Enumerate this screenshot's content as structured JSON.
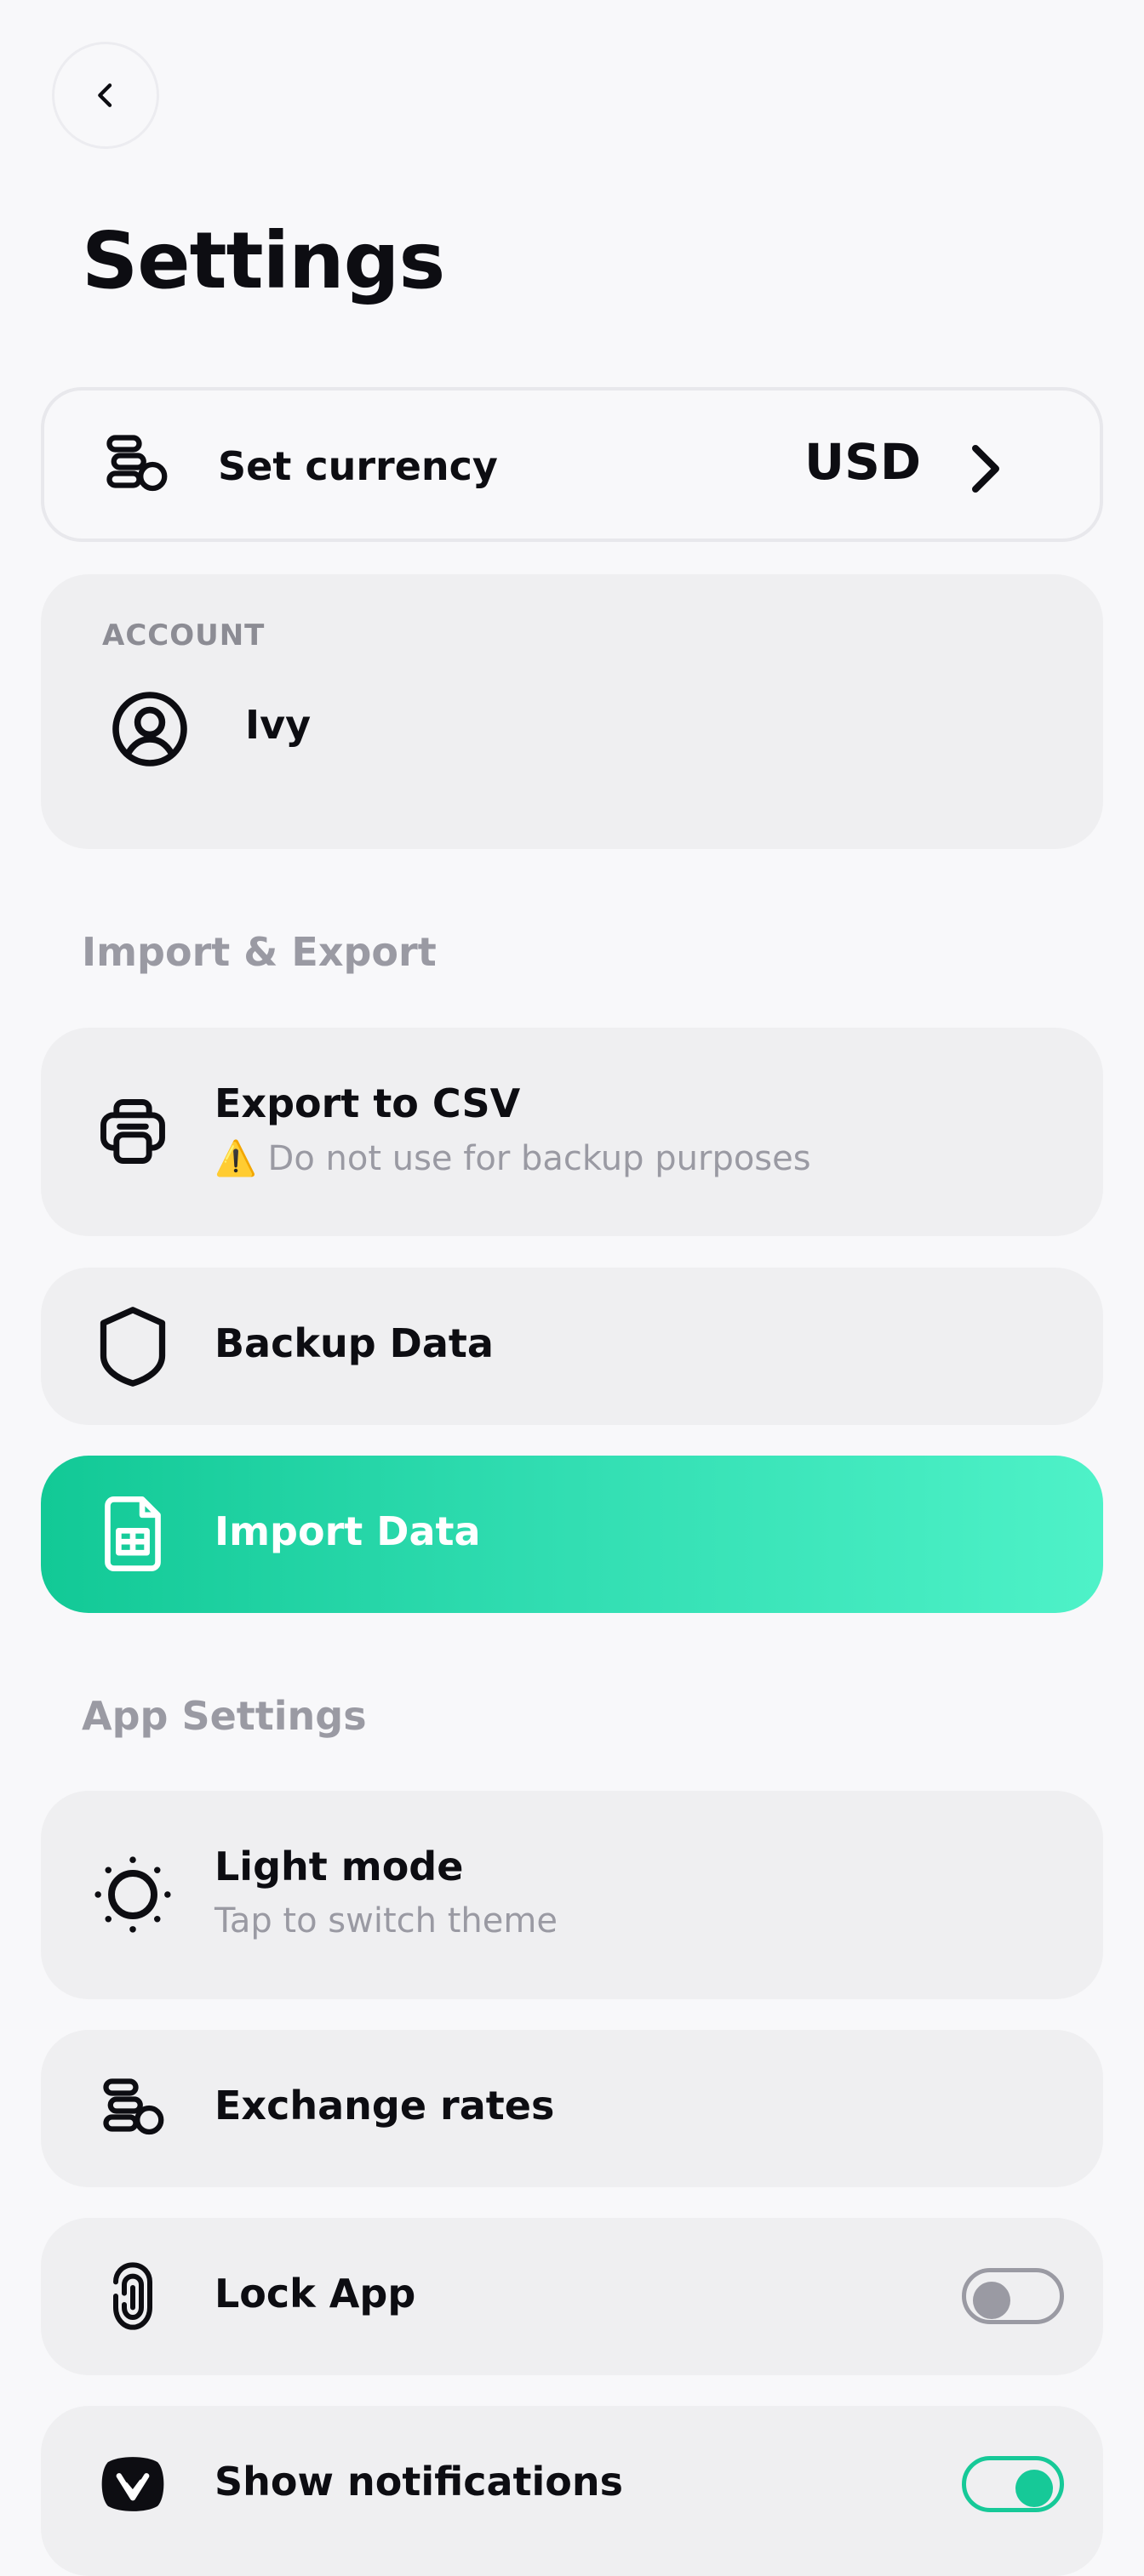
{
  "header": {
    "back_icon": "chevron-left-icon",
    "title": "Settings"
  },
  "currency": {
    "label": "Set currency",
    "value": "USD",
    "icon": "coins-icon"
  },
  "account": {
    "section_label": "ACCOUNT",
    "name": "Ivy",
    "icon": "user-circle-icon"
  },
  "import_export": {
    "section_title": "Import & Export",
    "export": {
      "label": "Export to CSV",
      "warning_emoji": "⚠️",
      "sublabel": "Do not use for backup purposes",
      "icon": "printer-icon"
    },
    "backup": {
      "label": "Backup Data",
      "icon": "shield-icon"
    },
    "import": {
      "label": "Import Data",
      "icon": "spreadsheet-file-icon",
      "gradient": [
        "#12c996",
        "#4ef2c8"
      ]
    }
  },
  "app_settings": {
    "section_title": "App Settings",
    "theme": {
      "label": "Light mode",
      "sublabel": "Tap to switch theme",
      "icon": "sun-icon"
    },
    "exchange": {
      "label": "Exchange rates",
      "icon": "coins-icon"
    },
    "lock": {
      "label": "Lock App",
      "icon": "fingerprint-icon",
      "enabled": false
    },
    "notifications": {
      "label": "Show notifications",
      "icon": "app-logo-icon",
      "enabled": true
    }
  },
  "colors": {
    "background": "#f8f8fa",
    "card": "#efeff1",
    "accent": "#16c998",
    "muted_text": "#9a9aa3"
  }
}
